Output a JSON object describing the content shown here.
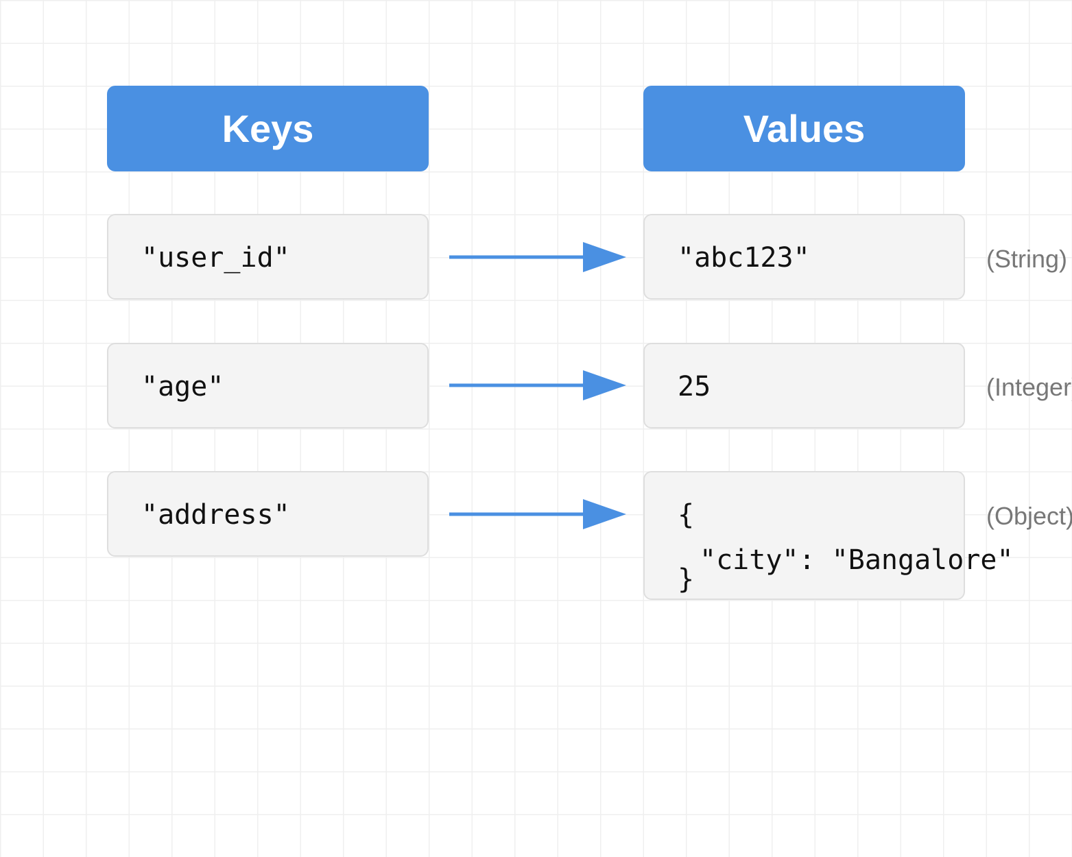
{
  "headers": {
    "keys": "Keys",
    "values": "Values"
  },
  "rows": [
    {
      "key": "\"user_id\"",
      "value": "\"abc123\"",
      "type": "(String)"
    },
    {
      "key": "\"age\"",
      "value": "25",
      "type": "(Integer)"
    },
    {
      "key": "\"address\"",
      "value_open": "{",
      "value_inner": "\"city\": \"Bangalore\"",
      "value_close": "}",
      "type": "(Object)"
    }
  ],
  "colors": {
    "accent": "#4a90e2",
    "box_fill": "#f4f4f4",
    "box_border": "#dedede",
    "type_text": "#777777"
  }
}
